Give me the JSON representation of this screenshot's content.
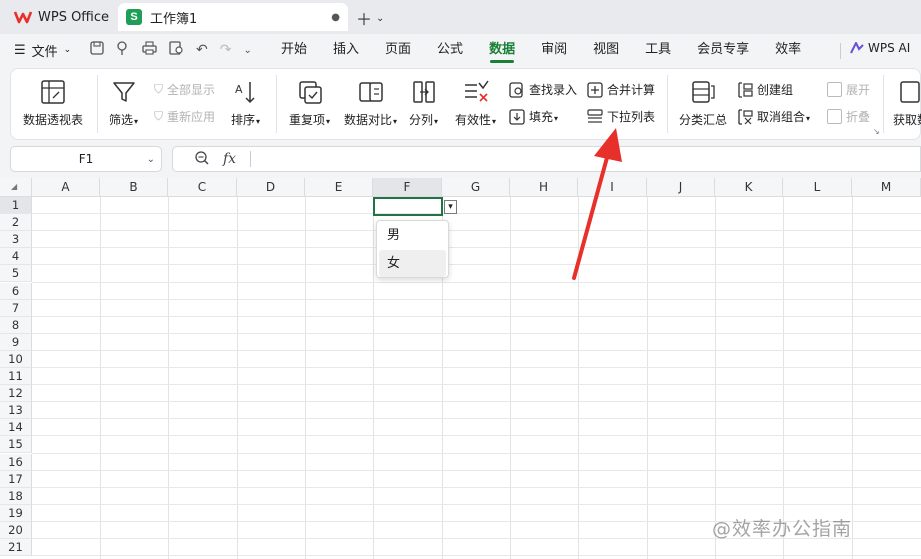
{
  "tabs": {
    "app_title": "WPS Office",
    "doc_title": "工作簿1",
    "doc_icon_letter": "S"
  },
  "menu": {
    "file_label": "文件",
    "tabs": [
      "开始",
      "插入",
      "页面",
      "公式",
      "数据",
      "审阅",
      "视图",
      "工具",
      "会员专享",
      "效率"
    ],
    "active_tab": "数据",
    "wps_ai": "WPS AI"
  },
  "ribbon": {
    "pivot": "数据透视表",
    "filter": "筛选",
    "show_all": "全部显示",
    "reapply": "重新应用",
    "sort": "排序",
    "duplicates": "重复项",
    "compare": "数据对比",
    "split": "分列",
    "validity": "有效性",
    "lookup_entry": "查找录入",
    "fill": "填充",
    "consolidate": "合并计算",
    "dropdown_list": "下拉列表",
    "subtotal": "分类汇总",
    "create_group": "创建组",
    "ungroup": "取消组合",
    "expand": "展开",
    "collapse": "折叠",
    "get_data": "获取数"
  },
  "formula_bar": {
    "name_box": "F1",
    "fx_label": "fx",
    "value": ""
  },
  "grid": {
    "columns": [
      "A",
      "B",
      "C",
      "D",
      "E",
      "F",
      "G",
      "H",
      "I",
      "J",
      "K",
      "L",
      "M"
    ],
    "rows": [
      "1",
      "2",
      "3",
      "4",
      "5",
      "6",
      "7",
      "8",
      "9",
      "10",
      "11",
      "12",
      "13",
      "14",
      "15",
      "16",
      "17",
      "18",
      "19",
      "20",
      "21"
    ],
    "selected_column": "F",
    "selected_row": "1"
  },
  "dropdown": {
    "options": [
      "男",
      "女"
    ],
    "highlighted": "女"
  },
  "watermark": "@效率办公指南",
  "colors": {
    "accent_green": "#1a7f37",
    "annotation_red": "#e8302a"
  }
}
